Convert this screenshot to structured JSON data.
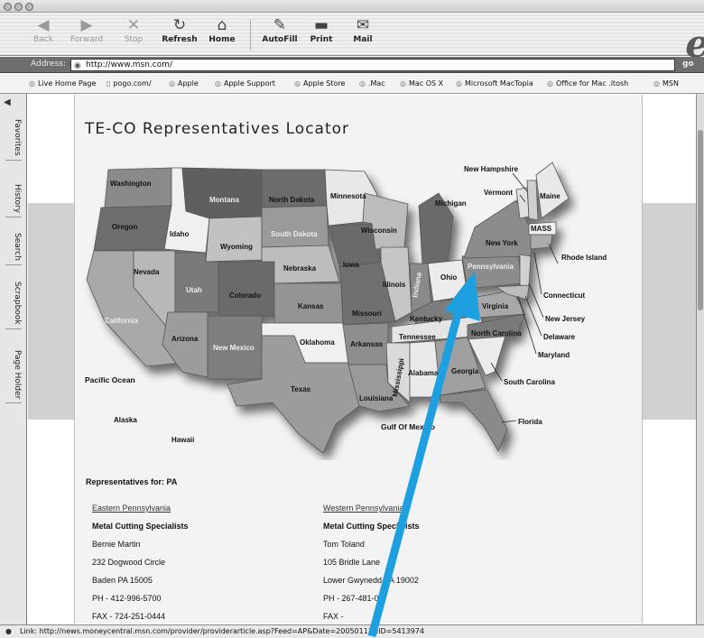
{
  "toolbar": {
    "back": "Back",
    "forward": "Forward",
    "stop": "Stop",
    "refresh": "Refresh",
    "home": "Home",
    "autofill": "AutoFill",
    "print": "Print",
    "mail": "Mail"
  },
  "address": {
    "label": "Address:",
    "url": "http://www.msn.com/",
    "go": "go"
  },
  "favorites": [
    "Live Home Page",
    "pogo.com/",
    "Apple",
    "Apple Support",
    "Apple Store",
    ".Mac",
    "Mac OS X",
    "Microsoft MacTopia",
    "Office for Mac .itosh",
    "MSN"
  ],
  "sidebar_tabs": [
    "Favorites",
    "History",
    "Search",
    "Scrapbook",
    "Page Holder"
  ],
  "page": {
    "title": "TE-CO Representatives Locator",
    "reps_heading": "Representatives for: PA"
  },
  "map": {
    "states": [
      "Washington",
      "Oregon",
      "Idaho",
      "Montana",
      "Wyoming",
      "North Dakota",
      "South Dakota",
      "Minnesota",
      "Wisconsin",
      "Michigan",
      "Nevada",
      "Utah",
      "Colorado",
      "Nebraska",
      "Iowa",
      "Illinois",
      "Indiana",
      "Ohio",
      "Pennsylvania",
      "New York",
      "Vermont",
      "New Hampshire",
      "Maine",
      "MASS",
      "Rhode Island",
      "Connecticut",
      "New Jersey",
      "Delaware",
      "Maryland",
      "California",
      "Arizona",
      "New Mexico",
      "Kansas",
      "Missouri",
      "Kentucky",
      "Virginia",
      "North Carolina",
      "Oklahoma",
      "Arkansas",
      "Tennessee",
      "Mississippi",
      "Alabama",
      "Georgia",
      "South Carolina",
      "Florida",
      "Texas",
      "Louisiana",
      "Alaska",
      "Hawaii"
    ],
    "geo": {
      "pacific": "Pacific Ocean",
      "gulf": "Gulf Of Mexico"
    }
  },
  "reps": {
    "eastern": {
      "region": "Eastern Pennsylvania",
      "company": "Metal Cutting Specialists",
      "name": "Bernie Martin",
      "street": "232 Dogwood Circle",
      "city": "Baden PA 15005",
      "phone": "PH - 412-996-5700",
      "fax": "FAX - 724-251-0444"
    },
    "western": {
      "region": "Western Pennsylvania",
      "company": "Metal Cutting Specialists",
      "name": "Tom Toland",
      "street": "105 Bridle Lane",
      "city": "Lower Gwynedd PA 19002",
      "phone": "PH - 267-481-0",
      "fax": "FAX -"
    }
  },
  "status": "Link: http://news.moneycentral.msn.com/provider/providerarticle.asp?Feed=AP&Date=20050113&ID=5413974",
  "colors": {
    "annotation_arrow": "#1e9fe0"
  }
}
